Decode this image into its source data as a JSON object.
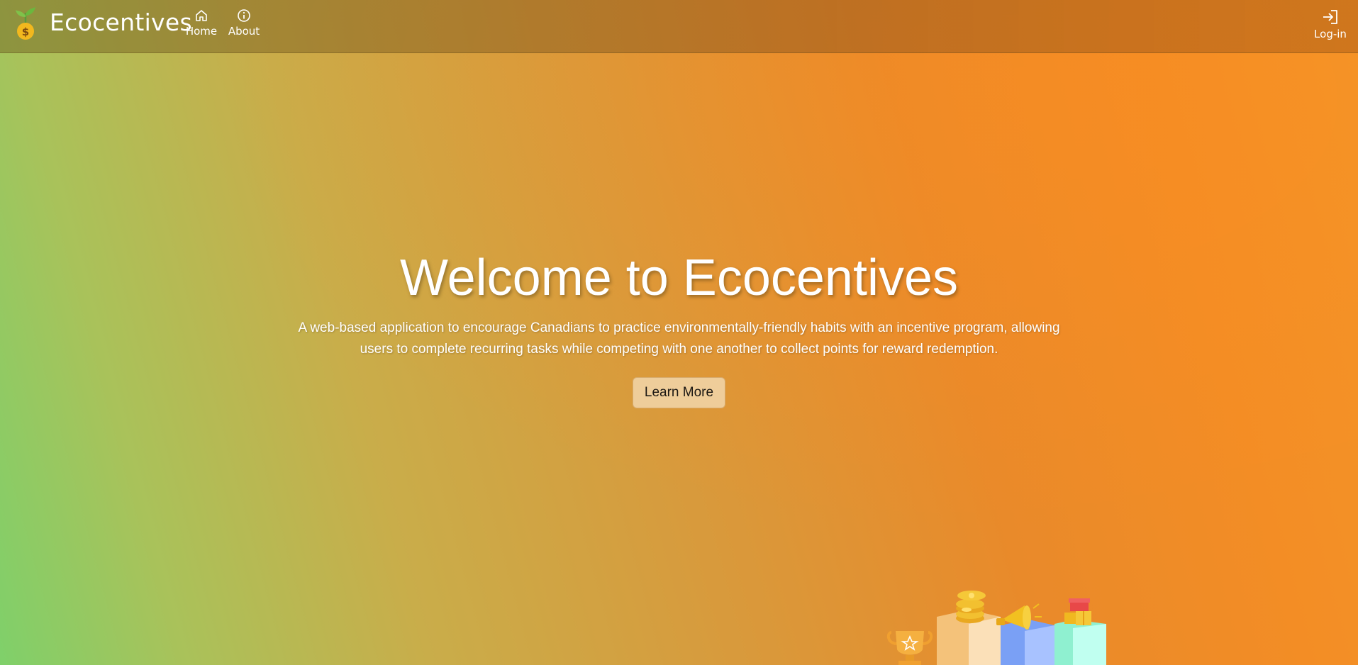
{
  "navbar": {
    "brand": "Ecocentives",
    "logo_icon": "money-sprout-icon",
    "items": [
      {
        "label": "Home",
        "icon": "home-icon"
      },
      {
        "label": "About",
        "icon": "info-icon"
      }
    ],
    "login": {
      "label": "Log-in",
      "icon": "login-icon"
    }
  },
  "hero": {
    "title": "Welcome to Ecocentives",
    "description": "A web-based application to encourage Canadians to practice environmentally-friendly habits with an incentive program, allowing users to complete recurring tasks while competing with one another to collect points for reward redemption.",
    "button_label": "Learn More"
  },
  "illustration": {
    "icon": "rewards-podium-icon"
  },
  "colors": {
    "gradient_left": "#7fd06a",
    "gradient_right": "#f39528",
    "button_bg": "#f0d0a0",
    "text": "#ffffff"
  }
}
